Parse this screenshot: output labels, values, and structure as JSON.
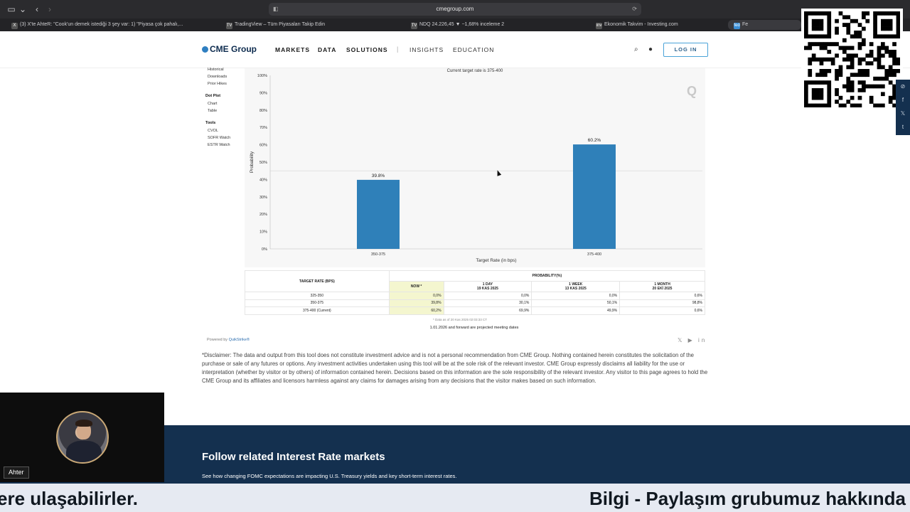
{
  "browser": {
    "url": "cmegroup.com",
    "tabs": [
      {
        "label": "(3) X'te AhteR: \"Cook'un demek istediği 3 şey var: 1) \"Piyasa çok pahalı,...",
        "icon": "X"
      },
      {
        "label": "TradingView – Tüm Piyasaları Takip Edin",
        "icon": "TV"
      },
      {
        "label": "NDQ 24.226,45 ▼ −1,68% inceleme 2",
        "icon": "TV"
      },
      {
        "label": "Ekonomik Takvim - Investing.com",
        "icon": "inv"
      },
      {
        "label": "Fe",
        "icon": "fed"
      }
    ]
  },
  "header": {
    "logo": "CME Group",
    "nav": [
      "MARKETS",
      "DATA",
      "SOLUTIONS"
    ],
    "separator": "|",
    "nav_secondary": [
      "INSIGHTS",
      "EDUCATION"
    ],
    "login": "LOG IN"
  },
  "sidebar": {
    "group1": [
      "Historical",
      "Downloads",
      "Prior Hikes"
    ],
    "group2_title": "Dot Plot",
    "group2": [
      "Chart",
      "Table"
    ],
    "group3_title": "Tools",
    "group3": [
      "CVOL",
      "SOFR Watch",
      "ESTR Watch"
    ]
  },
  "chart_data": {
    "type": "bar",
    "title": "Current target rate is 375-400",
    "categories": [
      "350-375",
      "375-400"
    ],
    "values": [
      39.8,
      60.2
    ],
    "data_labels": [
      "39.8%",
      "60.2%"
    ],
    "xlabel": "Target Rate (in bps)",
    "ylabel": "Probability",
    "ylim": [
      0,
      100
    ],
    "yticks": [
      "0%",
      "10%",
      "20%",
      "30%",
      "40%",
      "50%",
      "60%",
      "70%",
      "80%",
      "90%",
      "100%"
    ],
    "grid": false,
    "bar_color": "#2f80b9"
  },
  "watermark": "Q",
  "prob_table": {
    "col_target": "TARGET RATE (BPS)",
    "col_group": "PROBABILITY(%)",
    "col_now": "NOW *",
    "col_1day": [
      "1 DAY",
      "19 KAS 2025"
    ],
    "col_1week": [
      "1 WEEK",
      "13 KAS 2025"
    ],
    "col_1month": [
      "1 MONTH",
      "20 EKİ 2025"
    ],
    "rows": [
      {
        "rate": "325-350",
        "now": "0,0%",
        "d1": "0,0%",
        "w1": "0,0%",
        "m1": "0,6%"
      },
      {
        "rate": "350-375",
        "now": "39,8%",
        "d1": "30,1%",
        "w1": "50,1%",
        "m1": "98,8%"
      },
      {
        "rate": "375-400 (Current)",
        "now": "60,2%",
        "d1": "69,9%",
        "w1": "49,9%",
        "m1": "0,6%"
      }
    ],
    "data_as_of": "* Data as of 20 Kas 2025 02:03:33 CT",
    "projected_note": "1.01.2026 and forward are projected meeting dates"
  },
  "powered_by": {
    "prefix": "Powered by",
    "brand": "QuikStrike®"
  },
  "share_icons": "𝕏 ▶ in",
  "disclaimer": "*Disclaimer: The data and output from this tool does not constitute investment advice and is not a personal recommendation from CME Group.  Nothing contained herein constitutes the solicitation of the purchase or sale of any futures or options.  Any investment activities undertaken using this tool will be at the sole risk of the relevant investor.  CME Group expressly disclaims all liability for the use or interpretation (whether by visitor or by others) of information contained herein. Decisions based on this information are the sole responsibility of the relevant investor.  Any visitor to this page agrees to hold the CME Group and its affiliates and licensors harmless against any claims for damages arising from any decisions that the visitor makes based on such information.",
  "footer": {
    "title": "Follow related Interest Rate markets",
    "subtitle": "See how changing FOMC expectations are impacting U.S. Treasury yields and key short-term interest rates."
  },
  "webcam": {
    "name": "Ahter"
  },
  "social": [
    "f",
    "𝕏",
    "t"
  ],
  "ticker": {
    "left": "ere ulaşabilirler.",
    "right": "Bilgi - Paylaşım grubumuz hakkında b"
  }
}
